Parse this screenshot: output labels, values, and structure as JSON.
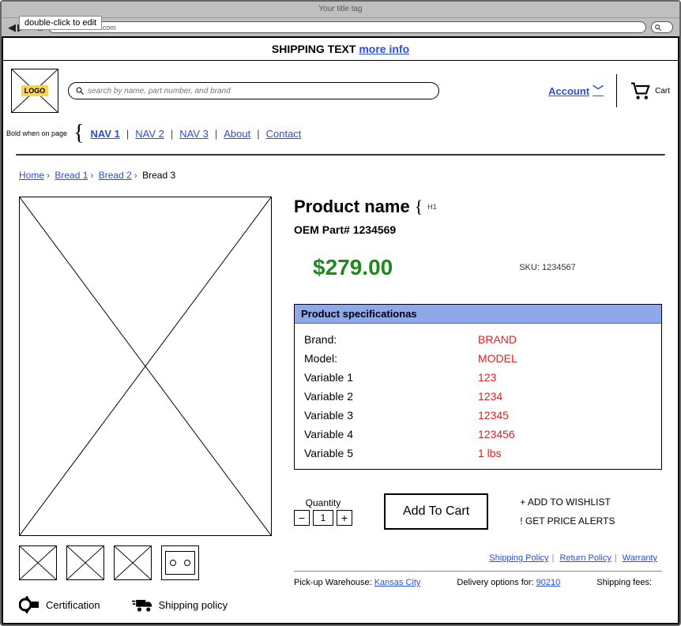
{
  "chrome": {
    "title": "Your title tag",
    "url": "://www.website.com",
    "tooltip": "double-click to edit"
  },
  "banner": {
    "text": "SHIPPING TEXT",
    "link": "more info"
  },
  "header": {
    "logo_text": "LOGO",
    "search_placeholder": "search by name, part number, and brand",
    "account": "Account",
    "cart": "Cart"
  },
  "nav": {
    "note": "Bold when on page",
    "items": [
      "NAV 1",
      "NAV 2",
      "NAV 3",
      "About",
      "Contact"
    ],
    "active_index": 0
  },
  "breadcrumbs": [
    "Home",
    "Bread 1",
    "Bread 2",
    "Bread 3"
  ],
  "product": {
    "name": "Product name",
    "h1_note": "H1",
    "oem_label": "OEM Part#",
    "oem_value": "1234569",
    "price": "$279.00",
    "sku_label": "SKU:",
    "sku_value": "1234567",
    "spec_header": "Product specificationas",
    "specs": [
      {
        "k": "Brand:",
        "v": "BRAND"
      },
      {
        "k": "Model:",
        "v": "MODEL"
      },
      {
        "k": "Variable 1",
        "v": "123"
      },
      {
        "k": "Variable 2",
        "v": "1234"
      },
      {
        "k": "Variable 3",
        "v": "12345"
      },
      {
        "k": "Variable 4",
        "v": "123456"
      },
      {
        "k": "Variable 5",
        "v": "1 lbs"
      }
    ],
    "qty_label": "Quantity",
    "qty_value": "1",
    "add_to_cart": "Add To Cart",
    "wishlist": "+ ADD TO WISHLIST",
    "alerts": "! GET PRICE ALERTS",
    "policies": [
      "Shipping Policy",
      "Return Policy",
      "Warranty"
    ],
    "pickup_label": "Pick-up Warehouse:",
    "pickup_value": "Kansas City",
    "delivery_label": "Delivery options for:",
    "delivery_value": "90210",
    "fees_label": "Shipping fees:"
  },
  "badges": {
    "cert": "Certification",
    "ship": "Shipping policy"
  }
}
